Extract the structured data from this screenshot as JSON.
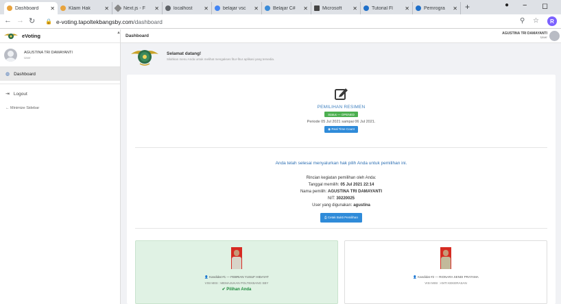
{
  "browser": {
    "tabs": [
      {
        "label": "Dashboard",
        "favicon_color": "#e8a33d",
        "active": true
      },
      {
        "label": "Klaim Hak",
        "favicon_color": "#e8a33d"
      },
      {
        "label": "Next.js - F",
        "favicon_color": "#888888"
      },
      {
        "label": "localhost",
        "favicon_color": "#5f6368"
      },
      {
        "label": "belajar vsc",
        "favicon_color": "#4285f4"
      },
      {
        "label": "Belajar C#",
        "favicon_color": "#3a8bd8"
      },
      {
        "label": "Microsoft",
        "favicon_color": "#444444"
      },
      {
        "label": "Tutorial Fl",
        "favicon_color": "#1e6fc9"
      },
      {
        "label": "Pemrogra",
        "favicon_color": "#1e6fc9"
      }
    ],
    "tab_close": "✕",
    "new_tab": "+",
    "url_host": "e-voting.tapoltekbangsby.com",
    "url_path": "/dashboard",
    "profile_letter": "R"
  },
  "sidebar": {
    "brand": "eVoting",
    "user_name": "AGUSTINA TRI DAMAYANTI",
    "user_role": "User",
    "menu": [
      {
        "label": "Dashboard",
        "icon": "dashboard-icon"
      },
      {
        "label": "Logout",
        "icon": "logout-icon"
      }
    ],
    "minimize_label": "Minimize Sidebar"
  },
  "header": {
    "title": "Dashboard",
    "user_name": "AGUSTINA TRI DAMAYANTI",
    "user_role": "User"
  },
  "welcome": {
    "title": "Selamat datang!",
    "subtitle": "Silahkan menu Anda untuk melihat mengakses fitur-fitur aplikasi yang tersedia."
  },
  "election": {
    "title": "PEMILIHAN RESIMEN",
    "status": "Status — OPENED",
    "period": "Periode 05 Jul 2021 sampai 06 Jul 2021.",
    "real_time_button": "Real Time Count",
    "notice": "Anda telah selesai menyalurkan hak pilih Anda untuk pemilihan ini.",
    "details_heading": "Rincian kegiatan pemilihan oleh Anda:",
    "chosen_date_label": "Tanggal memilih:",
    "chosen_date": "05 Jul 2021 22:14",
    "voter_name_label": "Nama pemilih:",
    "voter_name": "AGUSTINA TRI DAMAYANTI",
    "nit_label": "NIT:",
    "nit": "30220025",
    "username_label": "User yang digunakan:",
    "username": "agustina",
    "print_button": "Cetak Bukti Pemilihan"
  },
  "candidates": [
    {
      "label": "Kandidat #1 — FEBRIAN YUSUF HIDAYAT",
      "visi": "VISI MISI : MEMAJUKAN POLTEKBANG SBY",
      "chosen": true,
      "chosen_label": "Pilihan Anda"
    },
    {
      "label": "Kandidat #2 — RIONARA SENDI PRATAMA",
      "visi": "VISI MISI : ANTI KEKERASAN",
      "chosen": false
    }
  ],
  "colors": {
    "accent": "#2f8bd9",
    "success": "#4caf50",
    "chosen_bg": "#e0f2e4",
    "photo_bg": "#d62b22"
  }
}
